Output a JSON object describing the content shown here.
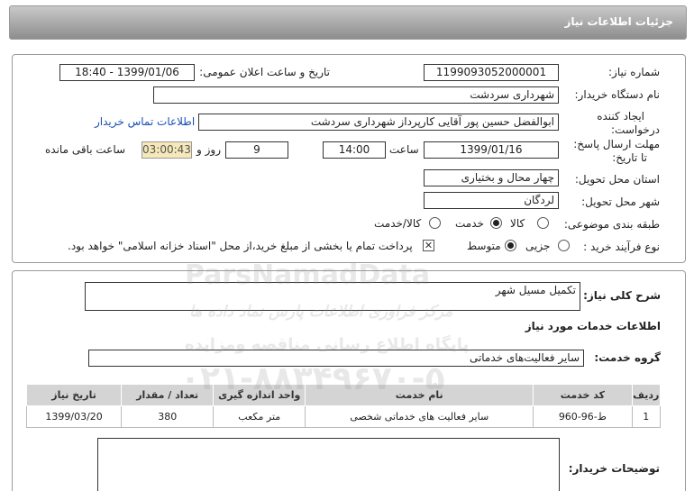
{
  "header": {
    "title": "جزئیات اطلاعات نیاز"
  },
  "fields": {
    "need_number_label": "شماره نیاز:",
    "need_number": "1199093052000001",
    "announce_label": "تاریخ و ساعت اعلان عمومی:",
    "announce_value": "1399/01/06 - 18:40",
    "buyer_org_label": "نام دستگاه خریدار:",
    "buyer_org": "شهرداری سردشت",
    "creator_label_1": "ایجاد کننده",
    "creator_label_2": "درخواست:",
    "creator": "ابوالفضل حسین پور آقایی کارپرداز شهرداری سردشت",
    "contact_link": "اطلاعات تماس خریدار",
    "deadline_label_1": "مهلت ارسال پاسخ:",
    "deadline_label_2": "تا تاریخ:",
    "deadline_date": "1399/01/16",
    "time_label": "ساعت",
    "deadline_time": "14:00",
    "days_value": "9",
    "days_label": "روز و",
    "remaining_time": "03:00:43",
    "remaining_label": "ساعت باقی مانده",
    "province_label": "استان محل تحویل:",
    "province": "چهار محال و بختیاری",
    "city_label": "شهر محل تحویل:",
    "city": "لردگان",
    "category_label": "طبقه بندی موضوعی:",
    "category_options": [
      "کالا",
      "خدمت",
      "کالا/خدمت"
    ],
    "category_selected": "خدمت",
    "process_label": "نوع فرآیند خرید :",
    "process_options": [
      "جزیی",
      "متوسط"
    ],
    "process_selected": "متوسط",
    "payment_note": "پرداخت تمام یا بخشی از مبلغ خرید،از محل \"اسناد خزانه اسلامی\" خواهد بود."
  },
  "details": {
    "description_label": "شرح کلی نیاز:",
    "description": "تکمیل مسیل شهر",
    "services_heading": "اطلاعات خدمات مورد نیاز",
    "service_group_label": "گروه خدمت:",
    "service_group": "سایر فعالیت‌های خدماتی",
    "table": {
      "headers": [
        "ردیف",
        "کد خدمت",
        "نام خدمت",
        "واحد اندازه گیری",
        "تعداد / مقدار",
        "تاریخ نیاز"
      ],
      "rows": [
        [
          "1",
          "ط-96-960",
          "سایر فعالیت های خدماتی شخصی",
          "متر مکعب",
          "380",
          "1399/03/20"
        ]
      ]
    },
    "buyer_notes_label": "توضیحات خریدار:"
  },
  "watermark": {
    "phone": "۰۲۱-۸۸۳۴۹۶۷۰-۵",
    "brand": "ParsNamadData",
    "line1": "مرکز فراوری اطلاعات پارس نماد داده ها",
    "line2": "پایگاه اطلاع رسانی مناقصه ومزایده"
  }
}
